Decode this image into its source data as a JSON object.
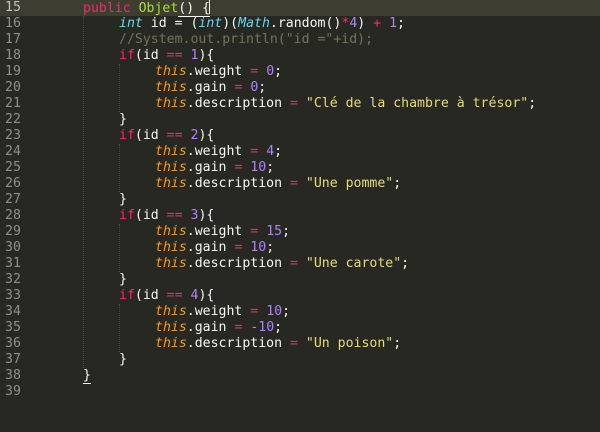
{
  "editor": {
    "current_line": "15",
    "lines": [
      {
        "no": "15",
        "t": [
          "public ",
          "Objet",
          "() {"
        ]
      },
      {
        "no": "16",
        "t": [
          "int",
          " id = (",
          "int",
          ")(",
          "Math",
          ".random()",
          "*",
          "4",
          ") ",
          "+",
          " ",
          "1",
          ";"
        ]
      },
      {
        "no": "17",
        "t": [
          "//System.out.println(\"id =\"+id);"
        ]
      },
      {
        "no": "18",
        "t": [
          "if",
          "(id ",
          "==",
          " ",
          "1",
          "){"
        ]
      },
      {
        "no": "19",
        "t": [
          "this",
          ".weight ",
          "=",
          " ",
          "0",
          ";"
        ]
      },
      {
        "no": "20",
        "t": [
          "this",
          ".gain ",
          "=",
          " ",
          "0",
          ";"
        ]
      },
      {
        "no": "21",
        "t": [
          "this",
          ".description ",
          "=",
          " ",
          "\"Clé de la chambre à trésor\"",
          ";"
        ]
      },
      {
        "no": "22",
        "t": [
          "}"
        ]
      },
      {
        "no": "23",
        "t": [
          "if",
          "(id ",
          "==",
          " ",
          "2",
          "){"
        ]
      },
      {
        "no": "24",
        "t": [
          "this",
          ".weight ",
          "=",
          " ",
          "4",
          ";"
        ]
      },
      {
        "no": "25",
        "t": [
          "this",
          ".gain ",
          "=",
          " ",
          "10",
          ";"
        ]
      },
      {
        "no": "26",
        "t": [
          "this",
          ".description ",
          "=",
          " ",
          "\"Une pomme\"",
          ";"
        ]
      },
      {
        "no": "27",
        "t": [
          "}"
        ]
      },
      {
        "no": "28",
        "t": [
          "if",
          "(id ",
          "==",
          " ",
          "3",
          "){"
        ]
      },
      {
        "no": "29",
        "t": [
          "this",
          ".weight ",
          "=",
          " ",
          "15",
          ";"
        ]
      },
      {
        "no": "30",
        "t": [
          "this",
          ".gain ",
          "=",
          " ",
          "10",
          ";"
        ]
      },
      {
        "no": "31",
        "t": [
          "this",
          ".description ",
          "=",
          " ",
          "\"Une carote\"",
          ";"
        ]
      },
      {
        "no": "32",
        "t": [
          "}"
        ]
      },
      {
        "no": "33",
        "t": [
          "if",
          "(id ",
          "==",
          " ",
          "4",
          "){"
        ]
      },
      {
        "no": "34",
        "t": [
          "this",
          ".weight ",
          "=",
          " ",
          "10",
          ";"
        ]
      },
      {
        "no": "35",
        "t": [
          "this",
          ".gain ",
          "=",
          " ",
          "-10",
          ";"
        ]
      },
      {
        "no": "36",
        "t": [
          "this",
          ".description ",
          "=",
          " ",
          "\"Un poison\"",
          ";"
        ]
      },
      {
        "no": "37",
        "t": [
          "}"
        ]
      },
      {
        "no": "38",
        "t": [
          "}"
        ]
      },
      {
        "no": "39",
        "t": []
      }
    ]
  }
}
